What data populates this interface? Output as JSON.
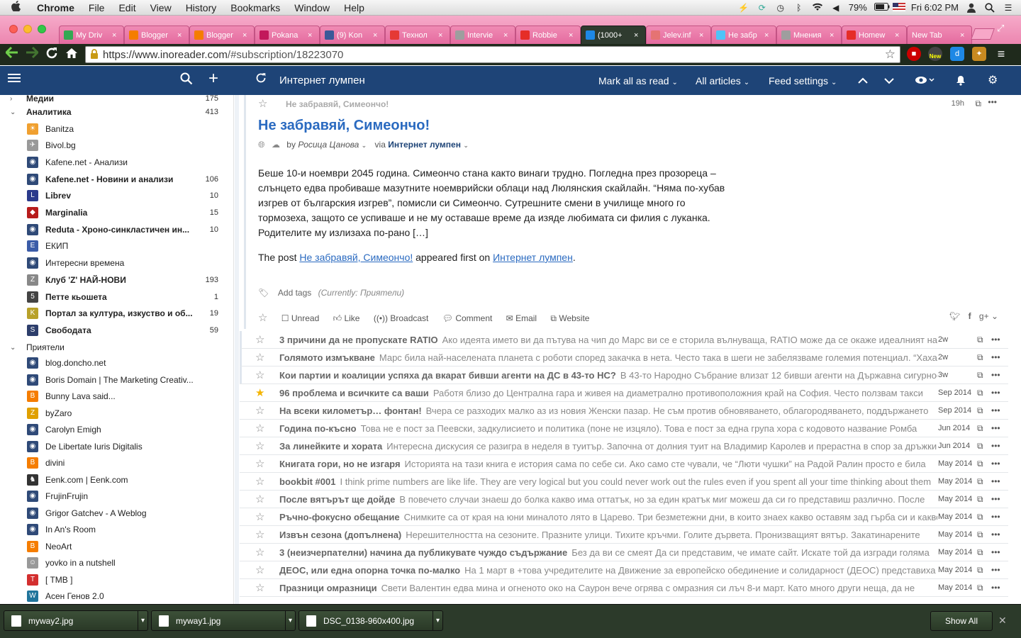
{
  "menubar": {
    "apple": "",
    "app": "Chrome",
    "items": [
      "File",
      "Edit",
      "View",
      "History",
      "Bookmarks",
      "Window",
      "Help"
    ],
    "battery": "79%",
    "clock": "Fri 6:02 PM"
  },
  "tabs": [
    {
      "label": "My Driv",
      "color": "#34a853"
    },
    {
      "label": "Blogger",
      "color": "#f57d00"
    },
    {
      "label": "Blogger",
      "color": "#f57d00"
    },
    {
      "label": "Pokana",
      "color": "#c2185b"
    },
    {
      "label": "(9) Kon",
      "color": "#3b5998"
    },
    {
      "label": "Технол",
      "color": "#e53935"
    },
    {
      "label": "Intervie",
      "color": "#9e9e9e"
    },
    {
      "label": "Robbie",
      "color": "#e52d27"
    },
    {
      "label": "(1000+",
      "color": "#1e88e5",
      "active": true
    },
    {
      "label": "Jelev.inf",
      "color": "#e57373"
    },
    {
      "label": "Не забр",
      "color": "#4fc3f7"
    },
    {
      "label": "Мнения",
      "color": "#9e9e9e"
    },
    {
      "label": "Homew",
      "color": "#e52d27"
    },
    {
      "label": "New Tab",
      "color": ""
    }
  ],
  "address": {
    "url_host": "https://www.inoreader.com",
    "url_path": "/#subscription/18223070"
  },
  "header": {
    "feed_title": "Интернет лумпен",
    "mark_all_read": "Mark all as read",
    "all_articles": "All articles",
    "feed_settings": "Feed settings"
  },
  "sidebar": {
    "top_partial": {
      "label": "Медии",
      "count": "175"
    },
    "folders": [
      {
        "label": "Аналитика",
        "count": "413"
      },
      {
        "label": "Приятели",
        "count": ""
      }
    ],
    "analytics_feeds": [
      {
        "label": "Banitza",
        "count": "",
        "bold": false,
        "icon": "☀",
        "color": "#f0a030"
      },
      {
        "label": "Bivol.bg",
        "count": "",
        "bold": false,
        "icon": "✈",
        "color": "#999"
      },
      {
        "label": "Kafene.net - Анализи",
        "count": "",
        "bold": false,
        "icon": "◉",
        "color": "#2f4a78"
      },
      {
        "label": "Kafene.net - Новини и анализи",
        "count": "106",
        "bold": true,
        "icon": "◉",
        "color": "#2f4a78"
      },
      {
        "label": "Librev",
        "count": "10",
        "bold": true,
        "icon": "L",
        "color": "#2b3a8c"
      },
      {
        "label": "Marginalia",
        "count": "15",
        "bold": true,
        "icon": "◆",
        "color": "#b71c1c"
      },
      {
        "label": "Reduta - Хроно-синкластичен ин...",
        "count": "10",
        "bold": true,
        "icon": "◉",
        "color": "#2f4a78"
      },
      {
        "label": "ЕКИП",
        "count": "",
        "bold": false,
        "icon": "E",
        "color": "#3b5ca8"
      },
      {
        "label": "Интересни времена",
        "count": "",
        "bold": false,
        "icon": "◉",
        "color": "#2f4a78"
      },
      {
        "label": "Клуб 'Z' НАЙ-НОВИ",
        "count": "193",
        "bold": true,
        "icon": "Z",
        "color": "#888"
      },
      {
        "label": "Петте кьошета",
        "count": "1",
        "bold": true,
        "icon": "5",
        "color": "#444"
      },
      {
        "label": "Портал за култура, изкуство и об...",
        "count": "19",
        "bold": true,
        "icon": "K",
        "color": "#b8a12a"
      },
      {
        "label": "Свободата",
        "count": "59",
        "bold": true,
        "icon": "S",
        "color": "#2d3e6b"
      }
    ],
    "friends_feeds": [
      {
        "label": "blog.doncho.net",
        "icon": "◉",
        "color": "#2f4a78"
      },
      {
        "label": "Boris Domain | The Marketing Creativ...",
        "icon": "◉",
        "color": "#2f4a78"
      },
      {
        "label": "Bunny Lava said...",
        "icon": "B",
        "color": "#f57d00"
      },
      {
        "label": "byZaro",
        "icon": "Z",
        "color": "#e0a000"
      },
      {
        "label": "Carolyn Emigh",
        "icon": "◉",
        "color": "#2f4a78"
      },
      {
        "label": "De Libertate Iuris Digitalis",
        "icon": "◉",
        "color": "#2f4a78"
      },
      {
        "label": "divini",
        "icon": "B",
        "color": "#f57d00"
      },
      {
        "label": "Eenk.com | Eenk.com",
        "icon": "♞",
        "color": "#333"
      },
      {
        "label": "FrujinFrujin",
        "icon": "◉",
        "color": "#2f4a78"
      },
      {
        "label": "Grigor Gatchev - A Weblog",
        "icon": "◉",
        "color": "#2f4a78"
      },
      {
        "label": "In An's Room",
        "icon": "◉",
        "color": "#2f4a78"
      },
      {
        "label": "NeoArt",
        "icon": "B",
        "color": "#f57d00"
      },
      {
        "label": "yovko in a nutshell",
        "icon": "☺",
        "color": "#999"
      },
      {
        "label": "[ TMB ]",
        "icon": "T",
        "color": "#d32f2f"
      },
      {
        "label": "Асен Генов 2.0",
        "icon": "W",
        "color": "#21759b"
      }
    ]
  },
  "article": {
    "feed_label": "Не забравяй, Симеончо!",
    "age": "19h",
    "title": "Не забравяй, Симеончо!",
    "by": "by",
    "author": "Росица Цанова",
    "via": "via",
    "via_feed": "Интернет лумпен",
    "body": "Беше 10-и ноември 2045 година. Симеончо стана както винаги трудно. Погледна през прозореца – слънцето едва пробиваше мазутните ноемврийски облаци над Люлянския скайлайн. “Няма по-хубав изгрев от българския изгрев”, помисли си Симеончо. Сутрешните смени в училище много го тормозеха, защото се успиваше и не му оставаше време да изяде любимата си филия с луканка. Родителите му излизаха по-рано […]",
    "post_prefix": "The post",
    "post_link": "Не забравяй, Симеончо!",
    "post_middle": "appeared first on",
    "post_site": "Интернет лумпен",
    "post_end": ".",
    "add_tags": "Add tags",
    "current_tags": "(Currently: Приятели)",
    "actions": [
      "Unread",
      "Like",
      "Broadcast",
      "Comment",
      "Email",
      "Website"
    ]
  },
  "articles": [
    {
      "title": "3 причини да не пропускате RATIO",
      "snippet": "Ако идеята името ви да пътува на чип до Марс ви се е сторила вълнуваща, RATIO може да се окаже идеалният начин",
      "date": "2w",
      "starred": false
    },
    {
      "title": "Голямото измъкване",
      "snippet": "Марс била най-населената планета с роботи според закачка в нета. Често така в шеги не забелязваме големия потенциал. “Хаха”",
      "date": "2w",
      "starred": false
    },
    {
      "title": "Кои партии и коалиции успяха да вкарат бивши агенти на ДС в 43-то НС?",
      "snippet": "В 43-то Народно Събрание влизат 12 бивши агенти на Държавна сигурност",
      "date": "3w",
      "starred": false
    },
    {
      "title": "96 проблема и всичките са ваши",
      "snippet": "Работя близо до Централна гара и живея на диаметрално противоположния край на София. Често ползвам такси",
      "date": "Sep 2014",
      "starred": true
    },
    {
      "title": "На всеки километър… фонтан!",
      "snippet": "Вчера се разходих малко аз из новия Женски пазар. Не съм против обновяването, облагородяването, поддържането",
      "date": "Sep 2014",
      "starred": false
    },
    {
      "title": "Година по-късно",
      "snippet": "Това не е пост за Пеевски, задкулисието и политика (поне не изцяло). Това е пост за една група хора с кодовото название Ромба",
      "date": "Jun 2014",
      "starred": false
    },
    {
      "title": "За линейките и хората",
      "snippet": "Интересна дискусия се разигра в неделя в туитър. Започна от долния туит на Владимир Каролев и прерастна в спор за дръжки",
      "date": "Jun 2014",
      "starred": false
    },
    {
      "title": "Книгата гори, но не изгаря",
      "snippet": "Историята на тази книга е история сама по себе си. Ако само сте чували, че “Люти чушки” на Радой Ралин просто е била",
      "date": "May 2014",
      "starred": false
    },
    {
      "title": "bookbit #001",
      "snippet": "I think prime numbers are like life. They are very logical but you could never work out the rules even if you spent all your time thinking about them",
      "date": "May 2014",
      "starred": false
    },
    {
      "title": "После вятърът ще дойде",
      "snippet": "В повечето случаи знаеш до болка какво има оттатък, но за един кратък миг можеш да си го представиш различно. После",
      "date": "May 2014",
      "starred": false
    },
    {
      "title": "Ръчно-фокусно обещание",
      "snippet": "Снимките са от края на юни миналото лято в Царево. Три безметежни дни, в които знаех какво оставям зад гърба си и какво",
      "date": "May 2014",
      "starred": false
    },
    {
      "title": "Извън сезона (допълнена)",
      "snippet": "Нерешителността на сезоните. Празните улици. Тихите кръчми. Голите дървета. Пронизващият вятър. Закатинарените",
      "date": "May 2014",
      "starred": false
    },
    {
      "title": "3 (неизчерпателни) начина да публикувате чуждо съдържание",
      "snippet": "Без да ви се смеят Да си представим, че имате сайт. Искате той да изгради голяма",
      "date": "May 2014",
      "starred": false
    },
    {
      "title": "ДЕОС, или една опорна точка по-малко",
      "snippet": "На 1 март в +това учредителите на Движение за европейско обединение и солидарност (ДЕОС) представиха",
      "date": "May 2014",
      "starred": false
    },
    {
      "title": "Празници омразници",
      "snippet": "Свети Валентин едва мина и огненото око на Саурон вече огрява с омразния си лъч 8-и март. Като много други неща, да не",
      "date": "May 2014",
      "starred": false
    }
  ],
  "downloads": {
    "items": [
      "myway2.jpg",
      "myway1.jpg",
      "DSC_0138-960x400.jpg"
    ],
    "show_all": "Show All"
  }
}
